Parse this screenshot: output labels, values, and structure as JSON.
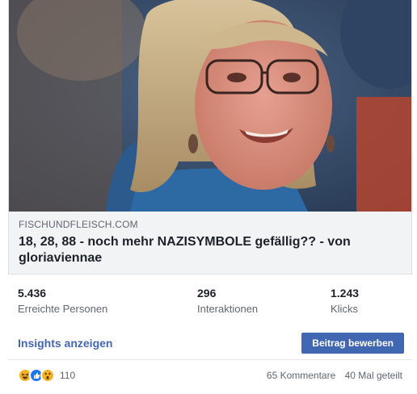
{
  "link": {
    "domain": "FISCHUNDFLEISCH.COM",
    "title": "18, 28, 88 - noch mehr NAZISYMBOLE gefällig?? - von gloriaviennae"
  },
  "stats": [
    {
      "value": "5.436",
      "label": "Erreichte Personen"
    },
    {
      "value": "296",
      "label": "Interaktionen"
    },
    {
      "value": "1.243",
      "label": "Klicks"
    }
  ],
  "actions": {
    "insights_label": "Insights anzeigen",
    "promote_label": "Beitrag bewerben"
  },
  "reactions": {
    "icons": [
      "haha-icon",
      "like-icon",
      "wow-icon"
    ],
    "count": "110",
    "comments": "65 Kommentare",
    "shares": "40 Mal geteilt"
  },
  "colors": {
    "accent": "#4267b2",
    "secondary_text": "#606770"
  }
}
